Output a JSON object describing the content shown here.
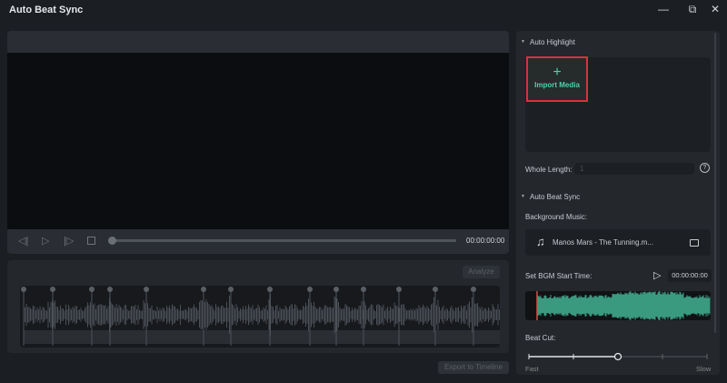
{
  "window": {
    "title": "Auto Beat Sync",
    "minimize": "—",
    "restore": "⧉",
    "close": "✕"
  },
  "player": {
    "time": "00:00:00:00",
    "progress": 0
  },
  "beat_panel": {
    "analyze": "Analyze",
    "export": "Export to Timeline",
    "beat_markers": [
      26,
      58,
      101,
      121,
      161,
      224,
      254,
      297,
      341,
      370,
      400,
      439,
      479,
      521
    ]
  },
  "right": {
    "auto_highlight": "Auto Highlight",
    "import_plus": "+",
    "import_label": "Import Media",
    "whole_length_label": "Whole Length:",
    "whole_length_value": "1",
    "help": "?",
    "auto_beat_sync": "Auto Beat Sync",
    "bg_music_label": "Background Music:",
    "music_file": "Manos Mars - The Tunning.m...",
    "bgm_start_label": "Set BGM Start Time:",
    "bgm_start_time": "00:00:00:00",
    "beat_cut_label": "Beat Cut:",
    "fast": "Fast",
    "slow": "Slow",
    "beat_cut_level": 2,
    "beat_cut_steps": 5,
    "accent": "#3a9a80",
    "highlight_border": "#d8323c"
  }
}
